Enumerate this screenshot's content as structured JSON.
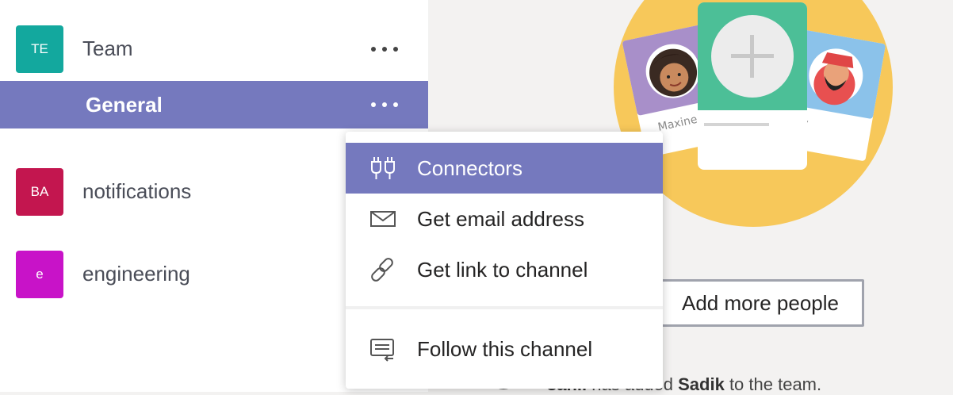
{
  "sidebar": {
    "teams": [
      {
        "initials": "TE",
        "name": "Team",
        "color": "#13a89e"
      },
      {
        "initials": "BA",
        "name": "notifications",
        "color": "#c3164f"
      },
      {
        "initials": "e",
        "name": "engineering",
        "color": "#c813c8"
      }
    ],
    "selected_channel": "General",
    "accent_color": "#7579be"
  },
  "illustration": {
    "card_left_name": "Maxine",
    "card_right_name_partial": "ky"
  },
  "main": {
    "add_people_label": "Add more people",
    "activity": {
      "actor": "sahil",
      "middle": " has added ",
      "target": "Sadik",
      "suffix": " to the team."
    }
  },
  "context_menu": {
    "items": [
      {
        "label": "Connectors",
        "icon": "connectors-icon",
        "active": true
      },
      {
        "label": "Get email address",
        "icon": "envelope-icon",
        "active": false
      },
      {
        "label": "Get link to channel",
        "icon": "link-icon",
        "active": false
      },
      {
        "label": "Follow this channel",
        "icon": "follow-channel-icon",
        "active": false
      }
    ]
  }
}
